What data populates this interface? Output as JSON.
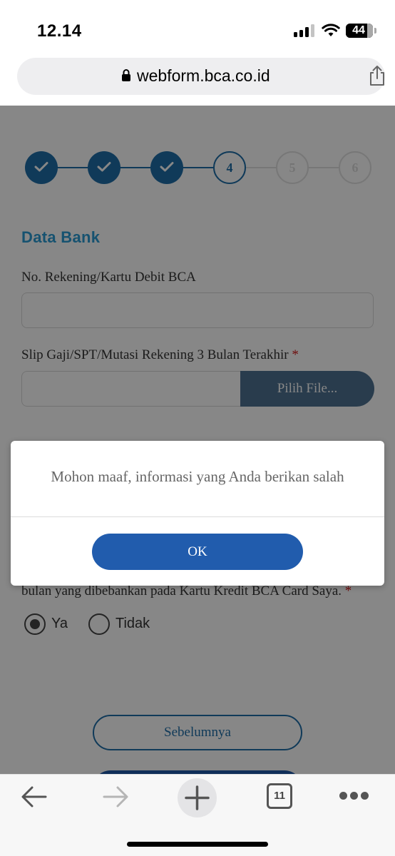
{
  "status_bar": {
    "time": "12.14",
    "battery_level": "44"
  },
  "browser": {
    "url": "webform.bca.co.id",
    "tab_count": "11"
  },
  "form": {
    "stepper": {
      "steps": [
        {
          "label": "",
          "state": "done"
        },
        {
          "label": "",
          "state": "done"
        },
        {
          "label": "",
          "state": "done"
        },
        {
          "label": "4",
          "state": "current"
        },
        {
          "label": "5",
          "state": "todo"
        },
        {
          "label": "6",
          "state": "todo"
        }
      ]
    },
    "section_title": "Data Bank",
    "account_label": "No. Rekening/Kartu Debit BCA",
    "account_value": "",
    "slip_label": "Slip Gaji/SPT/Mutasi Rekening 3 Bulan Terakhir",
    "required_mark": "*",
    "file_button": "Pilih File...",
    "consent_text": "bulan yang dibebankan pada Kartu Kredit BCA Card Saya.",
    "radio_options": [
      {
        "label": "Ya",
        "selected": true
      },
      {
        "label": "Tidak",
        "selected": false
      }
    ],
    "prev_button": "Sebelumnya"
  },
  "modal": {
    "message": "Mohon maaf, informasi yang Anda berikan salah",
    "ok_button": "OK"
  },
  "colors": {
    "accent": "#1f6fa8",
    "section_title": "#2a9bd3",
    "modal_button": "#215cad",
    "required": "#d41f1f"
  }
}
